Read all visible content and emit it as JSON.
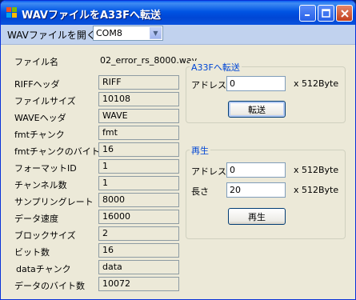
{
  "window": {
    "title": "WAVファイルをA33Fへ転送",
    "minimize_icon": "minimize-icon",
    "maximize_icon": "maximize-icon",
    "close_icon": "close-icon",
    "app_icon": "windows-app-icon"
  },
  "menu": {
    "open_label": "WAVファイルを開く",
    "port_value": "COM8"
  },
  "file": {
    "name_label": "ファイル名",
    "name_value": "02_error_rs_8000.wav"
  },
  "fields": [
    {
      "label": "RIFFヘッダ",
      "value": "RIFF"
    },
    {
      "label": "ファイルサイズ",
      "value": "10108"
    },
    {
      "label": "WAVEヘッダ",
      "value": "WAVE"
    },
    {
      "label": "fmtチャンク",
      "value": "fmt"
    },
    {
      "label": "fmtチャンクのバイト数",
      "value": "16"
    },
    {
      "label": "フォーマットID",
      "value": "1"
    },
    {
      "label": "チャンネル数",
      "value": "1"
    },
    {
      "label": "サンプリングレート",
      "value": "8000"
    },
    {
      "label": "データ速度",
      "value": "16000"
    },
    {
      "label": "ブロックサイズ",
      "value": "2"
    },
    {
      "label": "ビット数",
      "value": "16"
    },
    {
      "label": "dataチャンク",
      "value": "data"
    },
    {
      "label": "データのバイト数",
      "value": "10072"
    }
  ],
  "transfer": {
    "title": "A33Fへ転送",
    "address_label": "アドレス",
    "address_value": "0",
    "unit": "x 512Byte",
    "button": "転送"
  },
  "play": {
    "title": "再生",
    "address_label": "アドレス",
    "address_value": "0",
    "address_unit": "x 512Byte",
    "length_label": "長さ",
    "length_value": "20",
    "length_unit": "x 512Byte",
    "button": "再生"
  }
}
